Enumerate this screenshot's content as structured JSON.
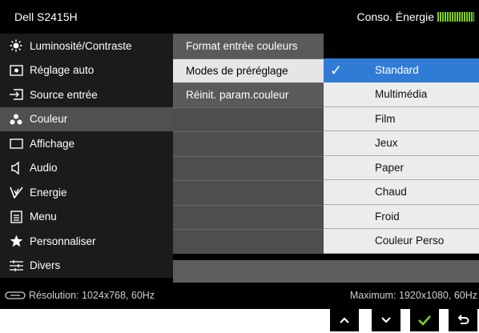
{
  "header": {
    "model": "Dell S2415H",
    "energy_label": "Conso. Énergie",
    "energy_color": "#7ed321"
  },
  "menu": {
    "items": [
      {
        "icon": "brightness-icon",
        "label": "Luminosité/Contraste"
      },
      {
        "icon": "auto-adjust-icon",
        "label": "Réglage auto"
      },
      {
        "icon": "input-source-icon",
        "label": "Source entrée"
      },
      {
        "icon": "color-icon",
        "label": "Couleur"
      },
      {
        "icon": "display-icon",
        "label": "Affichage"
      },
      {
        "icon": "audio-icon",
        "label": "Audio"
      },
      {
        "icon": "energy-icon",
        "label": "Energie"
      },
      {
        "icon": "menu-icon",
        "label": "Menu"
      },
      {
        "icon": "star-icon",
        "label": "Personnaliser"
      },
      {
        "icon": "others-icon",
        "label": "Divers"
      }
    ],
    "active_index": 3
  },
  "submenu": {
    "items": [
      {
        "label": "Format entrée couleurs"
      },
      {
        "label": "Modes de préréglage"
      },
      {
        "label": "Réinit. param.couleur"
      }
    ],
    "selected_index": 1
  },
  "options": {
    "items": [
      {
        "label": "Standard"
      },
      {
        "label": "Multimédia"
      },
      {
        "label": "Film"
      },
      {
        "label": "Jeux"
      },
      {
        "label": "Paper"
      },
      {
        "label": "Chaud"
      },
      {
        "label": "Froid"
      },
      {
        "label": "Couleur Perso"
      }
    ],
    "selected_index": 0,
    "check_glyph": "✓",
    "accent": "#2f7bd6"
  },
  "status": {
    "resolution": "Résolution: 1024x768, 60Hz",
    "maximum": "Maximum: 1920x1080, 60Hz"
  },
  "controls": {
    "up": "^",
    "down": "v",
    "ok": "✓",
    "back": "↰",
    "ok_color": "#7ed321"
  }
}
